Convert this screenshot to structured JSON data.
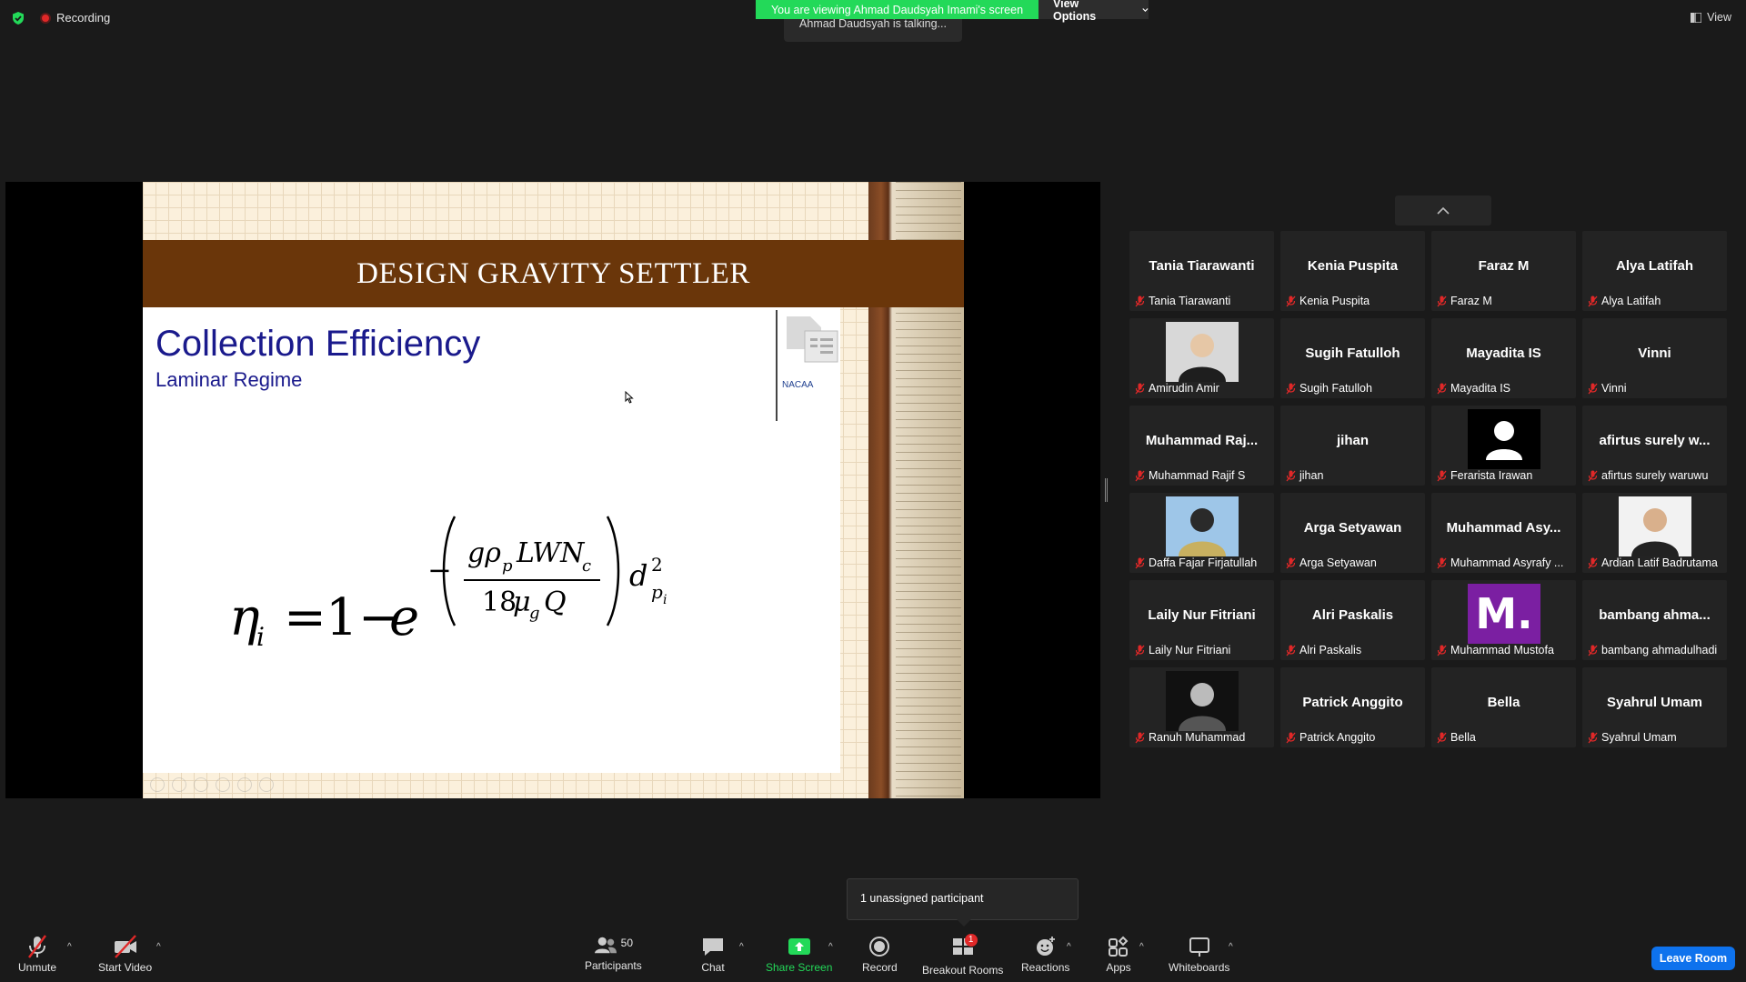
{
  "topbar": {
    "recording_label": "Recording",
    "viewing_banner": "You are viewing Ahmad Daudsyah Imami's screen",
    "view_options_label": "View Options",
    "talking_text": "Ahmad Daudsyah is talking...",
    "view_label": "View"
  },
  "slide": {
    "title": "DESIGN GRAVITY SETTLER",
    "heading": "Collection Efficiency",
    "subheading": "Laminar Regime",
    "logo_text": "NACAA"
  },
  "gallery": {
    "tiles": [
      {
        "display": "Tania Tiarawanti",
        "name": "Tania Tiarawanti"
      },
      {
        "display": "Kenia Puspita",
        "name": "Kenia Puspita"
      },
      {
        "display": "Faraz M",
        "name": "Faraz M"
      },
      {
        "display": "Alya Latifah",
        "name": "Alya Latifah"
      },
      {
        "display": "",
        "name": "Amirudin Amir"
      },
      {
        "display": "Sugih Fatulloh",
        "name": "Sugih Fatulloh"
      },
      {
        "display": "Mayadita IS",
        "name": "Mayadita IS"
      },
      {
        "display": "Vinni",
        "name": "Vinni"
      },
      {
        "display": "Muhammad Raj...",
        "name": "Muhammad Rajif S"
      },
      {
        "display": "jihan",
        "name": "jihan"
      },
      {
        "display": "",
        "name": "Ferarista Irawan"
      },
      {
        "display": "afirtus surely w...",
        "name": "afirtus surely waruwu"
      },
      {
        "display": "",
        "name": "Daffa Fajar Firjatullah"
      },
      {
        "display": "Arga Setyawan",
        "name": "Arga Setyawan"
      },
      {
        "display": "Muhammad Asy...",
        "name": "Muhammad Asyrafy ..."
      },
      {
        "display": "",
        "name": "Ardian Latif Badrutama"
      },
      {
        "display": "Laily Nur Fitriani",
        "name": "Laily Nur Fitriani"
      },
      {
        "display": "Alri Paskalis",
        "name": "Alri Paskalis"
      },
      {
        "display": "",
        "name": "Muhammad Mustofa"
      },
      {
        "display": "bambang ahma...",
        "name": "bambang ahmadulhadi"
      },
      {
        "display": "",
        "name": "Ranuh Muhammad"
      },
      {
        "display": "Patrick Anggito",
        "name": "Patrick Anggito"
      },
      {
        "display": "Bella",
        "name": "Bella"
      },
      {
        "display": "Syahrul Umam",
        "name": "Syahrul Umam"
      }
    ],
    "avatar_letter": "M."
  },
  "popup": {
    "unassigned_text": "1 unassigned participant"
  },
  "toolbar": {
    "unmute": "Unmute",
    "start_video": "Start Video",
    "participants_count": "50",
    "participants": "Participants",
    "chat": "Chat",
    "share_screen": "Share Screen",
    "record": "Record",
    "breakout_badge": "1",
    "breakout_rooms": "Breakout Rooms",
    "reactions": "Reactions",
    "apps": "Apps",
    "whiteboards": "Whiteboards",
    "leave_room": "Leave Room"
  },
  "colors": {
    "banner_green": "#23d959",
    "title_brown": "#6a360a",
    "heading_blue": "#1a1a8c",
    "leave_blue": "#0e72ed",
    "share_green": "#23d959",
    "avatar_purple": "#7b1fa2"
  }
}
